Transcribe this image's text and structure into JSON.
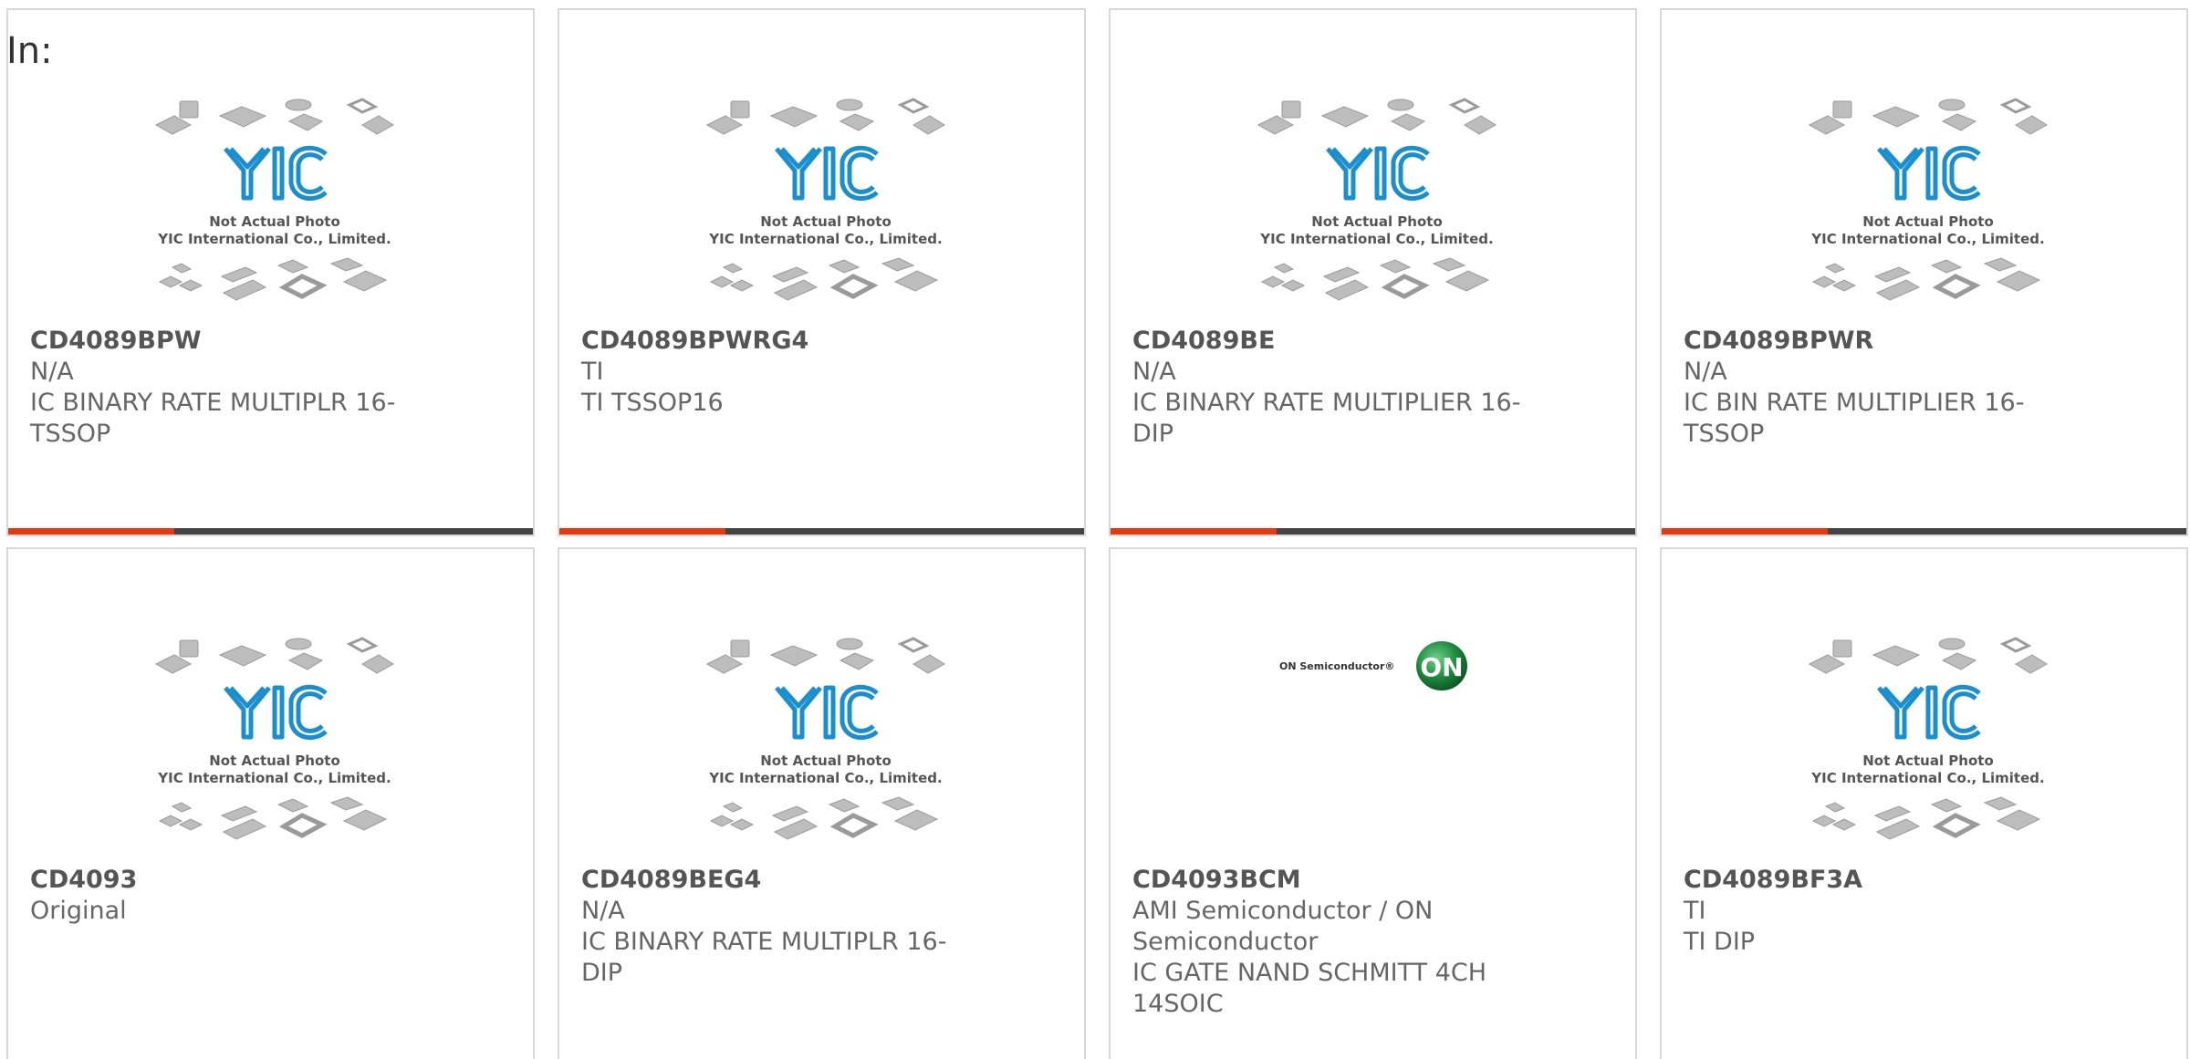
{
  "heading": "In:",
  "placeholder_image": {
    "caption1": "Not Actual Photo",
    "caption2": "YIC International Co., Limited.",
    "logo_text": "YIC"
  },
  "onsemi_logo": {
    "wordmark": "ON Semiconductor®",
    "badge": "ON"
  },
  "products": [
    {
      "part": "CD4089BPW",
      "line1": "N/A",
      "line2": "IC BINARY RATE MULTIPLR 16-",
      "line3": "TSSOP",
      "image": "yic-placeholder"
    },
    {
      "part": "CD4089BPWRG4",
      "line1": "TI",
      "line2": "TI TSSOP16",
      "line3": "",
      "image": "yic-placeholder"
    },
    {
      "part": "CD4089BE",
      "line1": "N/A",
      "line2": "IC BINARY RATE MULTIPLIER 16-",
      "line3": "DIP",
      "image": "yic-placeholder"
    },
    {
      "part": "CD4089BPWR",
      "line1": "N/A",
      "line2": "IC BIN RATE MULTIPLIER 16-",
      "line3": "TSSOP",
      "image": "yic-placeholder"
    },
    {
      "part": "CD4093",
      "line1": "Original",
      "line2": "",
      "line3": "",
      "image": "yic-placeholder"
    },
    {
      "part": "CD4089BEG4",
      "line1": "N/A",
      "line2": "IC BINARY RATE MULTIPLR 16-",
      "line3": "DIP",
      "image": "yic-placeholder"
    },
    {
      "part": "CD4093BCM",
      "line1": "AMI Semiconductor / ON",
      "line1b": "Semiconductor",
      "line2": "IC GATE NAND SCHMITT 4CH",
      "line3": "14SOIC",
      "image": "onsemi-logo"
    },
    {
      "part": "CD4089BF3A",
      "line1": "TI",
      "line2": "TI DIP",
      "line3": "",
      "image": "yic-placeholder"
    }
  ],
  "colors": {
    "accent": "#e43a12",
    "bar": "#444444",
    "border": "#d8d8d8",
    "logo_blue": "#1a8fd0",
    "onsemi_green": "#1e8a3c"
  }
}
